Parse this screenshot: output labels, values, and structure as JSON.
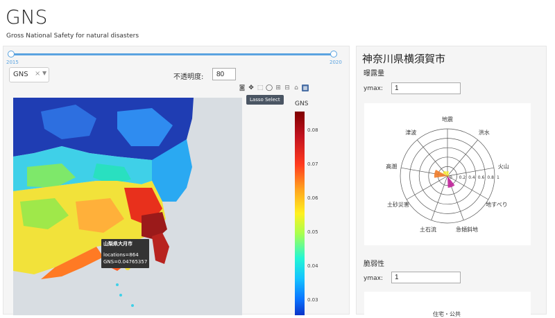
{
  "app": {
    "title": "GNS",
    "subtitle": "Gross National Safety for natural disasters"
  },
  "controls": {
    "year_min": "2015",
    "year_max": "2020",
    "selected_year": 2020,
    "layer_select_value": "GNS",
    "opacity_label": "不透明度:",
    "opacity_value": "80",
    "lasso_tooltip": "Lasso Select",
    "modebar_icons": [
      "camera-icon",
      "pan-icon",
      "box-select-icon",
      "lasso-icon",
      "zoom-in-icon",
      "zoom-out-icon",
      "home-icon",
      "plotly-logo-icon"
    ]
  },
  "map": {
    "colorbar_title": "GNS",
    "colorbar_ticks": [
      "0.08",
      "0.07",
      "0.06",
      "0.05",
      "0.04",
      "0.03"
    ],
    "hover": {
      "place": "山梨県大月市",
      "locations": "locations=864",
      "gns": "GNS=0.04765357"
    }
  },
  "side": {
    "city_title": "神奈川県横須賀市",
    "exposure_label": "曝露量",
    "ymax_label": "ymax:",
    "ymax_value_1": "1",
    "radar_axes": [
      "地震",
      "洪水",
      "火山",
      "地すべり",
      "急傾斜地",
      "土石流",
      "土砂災害",
      "高潮",
      "津波"
    ],
    "radar_ticks": [
      "0",
      "0.2",
      "0.4",
      "0.6",
      "0.8",
      "1"
    ],
    "vulnerability_label": "脆弱性",
    "ymax_value_2": "1",
    "card2_axis_label": "住宅・公共"
  },
  "chart_data": {
    "type": "radar",
    "axes": [
      "地震",
      "洪水",
      "火山",
      "地すべり",
      "急傾斜地",
      "土石流",
      "土砂災害",
      "高潮",
      "津波"
    ],
    "values": [
      0.1,
      0.05,
      0.02,
      0.03,
      0.25,
      0.03,
      0.02,
      0.28,
      0.12
    ],
    "colors": [
      "#f5ea2d",
      "#f5ea2d",
      "#f5ea2d",
      "#e2a028",
      "#c0249a",
      "#e2a028",
      "#e2a028",
      "#f07c2a",
      "#f5ea2d"
    ],
    "rmax": 1,
    "ticks": [
      0,
      0.2,
      0.4,
      0.6,
      0.8,
      1
    ]
  }
}
